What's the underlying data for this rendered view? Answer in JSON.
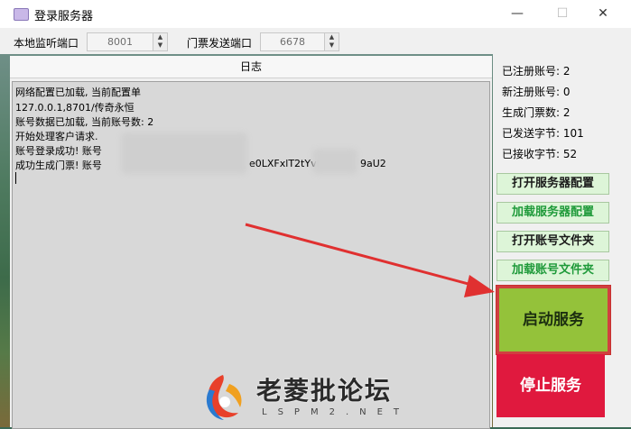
{
  "window": {
    "title": "登录服务器",
    "minimize": "—",
    "maximize": "☐",
    "close": "✕"
  },
  "ports": {
    "listen_label": "本地监听端口",
    "listen_value": "8001",
    "ticket_label": "门票发送端口",
    "ticket_value": "6678"
  },
  "log": {
    "header": "日志",
    "lines": [
      "网络配置已加载, 当前配置单",
      "127.0.0.1,8701/传奇永恒",
      "账号数据已加载, 当前账号数: 2",
      "开始处理客户请求.",
      "账号登录成功!  账号",
      "成功生成门票!  账号",
      "e0LXFxlT2tYvk0",
      "9aU2"
    ]
  },
  "stats": {
    "registered": "已注册账号: 2",
    "new_registered": "新注册账号: 0",
    "tickets": "生成门票数: 2",
    "sent_bytes": "已发送字节: 101",
    "recv_bytes": "已接收字节: 52"
  },
  "buttons": {
    "open_server_config": "打开服务器配置",
    "load_server_config": "加载服务器配置",
    "open_account_folder": "打开账号文件夹",
    "load_account_folder": "加载账号文件夹",
    "start": "启动服务",
    "stop": "停止服务"
  },
  "watermark": {
    "text": "老菱批论坛",
    "sub": "LSPM2.NET"
  },
  "colors": {
    "start_bg": "#94c23a",
    "stop_bg": "#e0193e",
    "annotation": "#e03030"
  }
}
